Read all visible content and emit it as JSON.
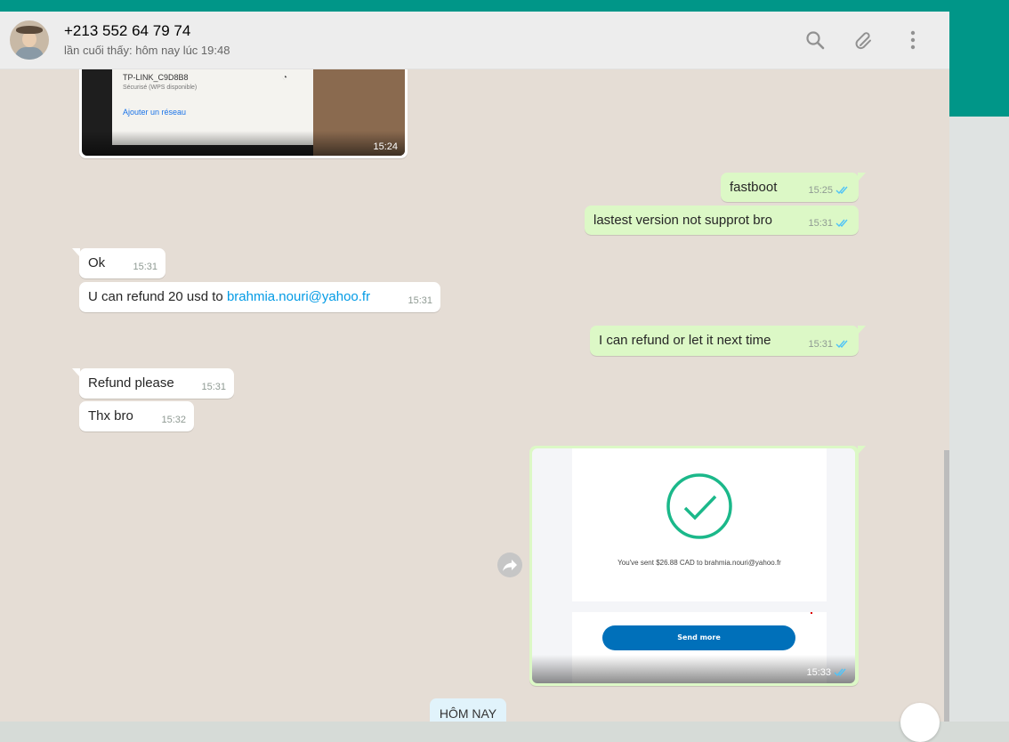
{
  "header": {
    "contact_name": "+213 552 64 79 74",
    "last_seen": "lần cuối thấy: hôm nay lúc 19:48",
    "icons": [
      "search-icon",
      "attach-icon",
      "menu-icon"
    ]
  },
  "colors": {
    "brand": "#009688",
    "outgoing": "#dcf8c6",
    "incoming": "#ffffff",
    "chat_bg": "#e5ddd5",
    "read_tick": "#4fc3f7",
    "link": "#039be5"
  },
  "messages": {
    "img_in": {
      "wifi_name": "TP-LINK_C9D8B8",
      "wifi_status": "Sécurisé (WPS disponible)",
      "add_network": "Ajouter un réseau",
      "time": "15:24"
    },
    "m1": {
      "text": "fastboot",
      "time": "15:25"
    },
    "m2": {
      "text": "lastest version not supprot bro",
      "time": "15:31"
    },
    "m3": {
      "text": "Ok",
      "time": "15:31"
    },
    "m4": {
      "text": "U can refund 20 usd to ",
      "link": "brahmia.nouri@yahoo.fr",
      "time": "15:31"
    },
    "m5": {
      "text": "I can refund or let it next time",
      "time": "15:31"
    },
    "m6": {
      "text": "Refund please",
      "time": "15:31"
    },
    "m7": {
      "text": "Thx bro",
      "time": "15:32"
    },
    "img_out": {
      "sent_text": "You've sent $26.88 CAD to brahmia.nouri@yahoo.fr",
      "button_label": "Send more",
      "time": "15:33"
    }
  },
  "date_divider": "HÔM NAY"
}
